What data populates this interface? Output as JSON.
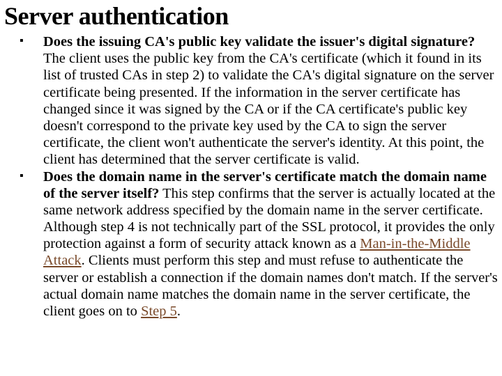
{
  "heading": "Server authentication",
  "items": [
    {
      "bullet": "▪",
      "question": "Does the issuing CA's public key validate the issuer's digital signature?",
      "body": " The client uses the public key from the CA's certificate (which it found in its list of trusted CAs in step 2) to validate the CA's digital signature on the server certificate being presented. If the information in the server certificate has changed since it was signed by the CA or if the CA certificate's public key doesn't correspond to the private key used by the CA to sign the server certificate, the client won't authenticate the server's identity. At this point, the client has determined that the server certificate is valid."
    },
    {
      "bullet": "▪",
      "question": "Does the domain name in the server's certificate match the domain name of the server itself?",
      "body_pre": " This step confirms that the server is actually located at the same network address specified by the domain name in the server certificate. Although step 4 is not technically part of the SSL protocol, it provides the only protection against a form of security attack known as a ",
      "link1": "Man-in-the-Middle Attack",
      "body_mid": ". Clients must perform this step and must refuse to authenticate the server or establish a connection if the domain names don't match. If the server's actual domain name matches the domain name in the server certificate, the client goes on to ",
      "link2": "Step 5",
      "body_post": "."
    }
  ]
}
